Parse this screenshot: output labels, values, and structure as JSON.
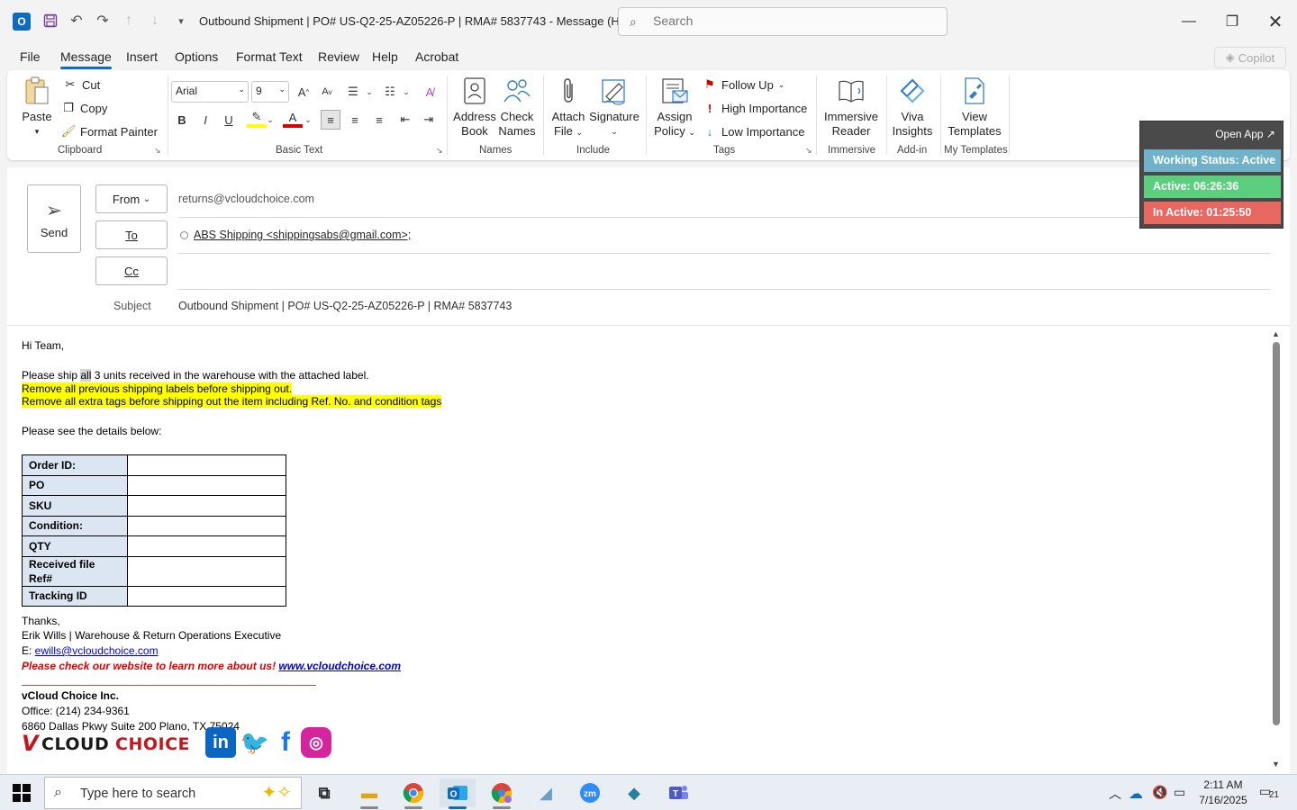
{
  "window": {
    "title": "Outbound Shipment | PO# US-Q2-25-AZ05226-P | RMA# 5837743  -  Message (HT...",
    "search_placeholder": "Search"
  },
  "menu": {
    "tabs": [
      "File",
      "Message",
      "Insert",
      "Options",
      "Format Text",
      "Review",
      "Help",
      "Acrobat"
    ],
    "active": "Message",
    "copilot_label": "Copilot"
  },
  "ribbon": {
    "clipboard": {
      "label": "Clipboard",
      "paste": "Paste",
      "cut": "Cut",
      "copy": "Copy",
      "format_painter": "Format Painter"
    },
    "basic_text": {
      "label": "Basic Text",
      "font": "Arial",
      "size": "9"
    },
    "names": {
      "label": "Names",
      "address_book_1": "Address",
      "address_book_2": "Book",
      "check_names_1": "Check",
      "check_names_2": "Names"
    },
    "include": {
      "label": "Include",
      "attach_1": "Attach",
      "attach_2": "File",
      "signature": "Signature"
    },
    "tags": {
      "label": "Tags",
      "assign_1": "Assign",
      "assign_2": "Policy",
      "follow_up": "Follow Up",
      "high": "High Importance",
      "low": "Low Importance"
    },
    "immersive": {
      "label": "Immersive",
      "reader_1": "Immersive",
      "reader_2": "Reader"
    },
    "addin": {
      "label": "Add-in",
      "viva_1": "Viva",
      "viva_2": "Insights"
    },
    "templates": {
      "label": "My Templates",
      "view_1": "View",
      "view_2": "Templates"
    }
  },
  "compose": {
    "send": "Send",
    "from_label": "From",
    "from_value": "returns@vcloudchoice.com",
    "to_label": "To",
    "to_value": "ABS Shipping <shippingsabs@gmail.com>;",
    "cc_label": "Cc",
    "subject_label": "Subject",
    "subject_value": "Outbound Shipment | PO# US-Q2-25-AZ05226-P | RMA# 5837743"
  },
  "body": {
    "greeting": "Hi Team,",
    "line1_a": "Please ship ",
    "line1_sel": "all",
    "line1_b": " 3 units received in the warehouse with the attached label.",
    "line2": "Remove all previous shipping labels before shipping out.",
    "line3": "Remove all extra tags before shipping out the item including Ref. No. and condition tags",
    "line4": "Please see the details below:",
    "table": [
      {
        "key": "Order ID:",
        "value": ""
      },
      {
        "key": "PO",
        "value": ""
      },
      {
        "key": "SKU",
        "value": ""
      },
      {
        "key": "Condition:",
        "value": ""
      },
      {
        "key": "QTY",
        "value": ""
      },
      {
        "key": "Received file Ref#",
        "value": ""
      },
      {
        "key": "Tracking ID",
        "value": ""
      }
    ],
    "thanks": "Thanks,",
    "sig_name": "Erik Wills | Warehouse & Return Operations Executive",
    "sig_email_label": "E: ",
    "sig_email": "ewills@vcloudchoice.com",
    "sig_note": "Please check our website to learn more about us! ",
    "sig_site": "www.vcloudchoice.com",
    "company": "vCloud Choice Inc.",
    "office": "Office: (214) 234-9361",
    "address": "6860 Dallas Pkwy Suite 200 Plano, TX 75024",
    "logo_text": "VCLOUDCHOICE"
  },
  "widget": {
    "open_app": "Open App ↗",
    "working": "Working Status: Active",
    "active": "Active: 06:26:36",
    "inactive": "In Active: 01:25:50",
    "colors": {
      "working": "#6fb2c9",
      "active": "#5ccf7f",
      "inactive": "#e8675f"
    }
  },
  "taskbar": {
    "search_text": "Type here to search",
    "time": "2:11 AM",
    "date": "7/16/2025",
    "notif_count": "21"
  }
}
